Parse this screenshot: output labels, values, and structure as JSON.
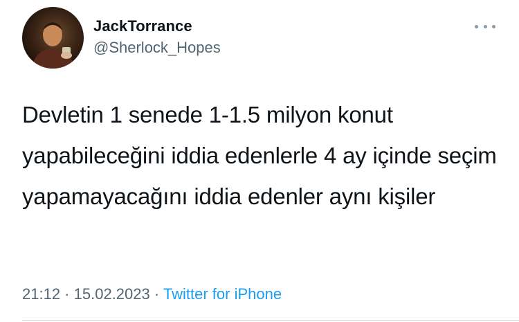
{
  "author": {
    "display_name": "JackTorrance",
    "handle": "@Sherlock_Hopes",
    "avatar_icon": "profile-photo"
  },
  "more_icon": "more-horizontal-icon",
  "tweet": {
    "text": "Devletin 1 senede 1-1.5 milyon konut yapabileceğini iddia edenlerle 4 ay içinde seçim yapamayacağını iddia edenler aynı kişiler"
  },
  "meta": {
    "time": "21:12",
    "separator1": " · ",
    "date": "15.02.2023",
    "separator2": " · ",
    "source": "Twitter for iPhone"
  },
  "colors": {
    "link": "#1d9bf0",
    "secondary_text": "#536471",
    "primary_text": "#0f1419"
  }
}
